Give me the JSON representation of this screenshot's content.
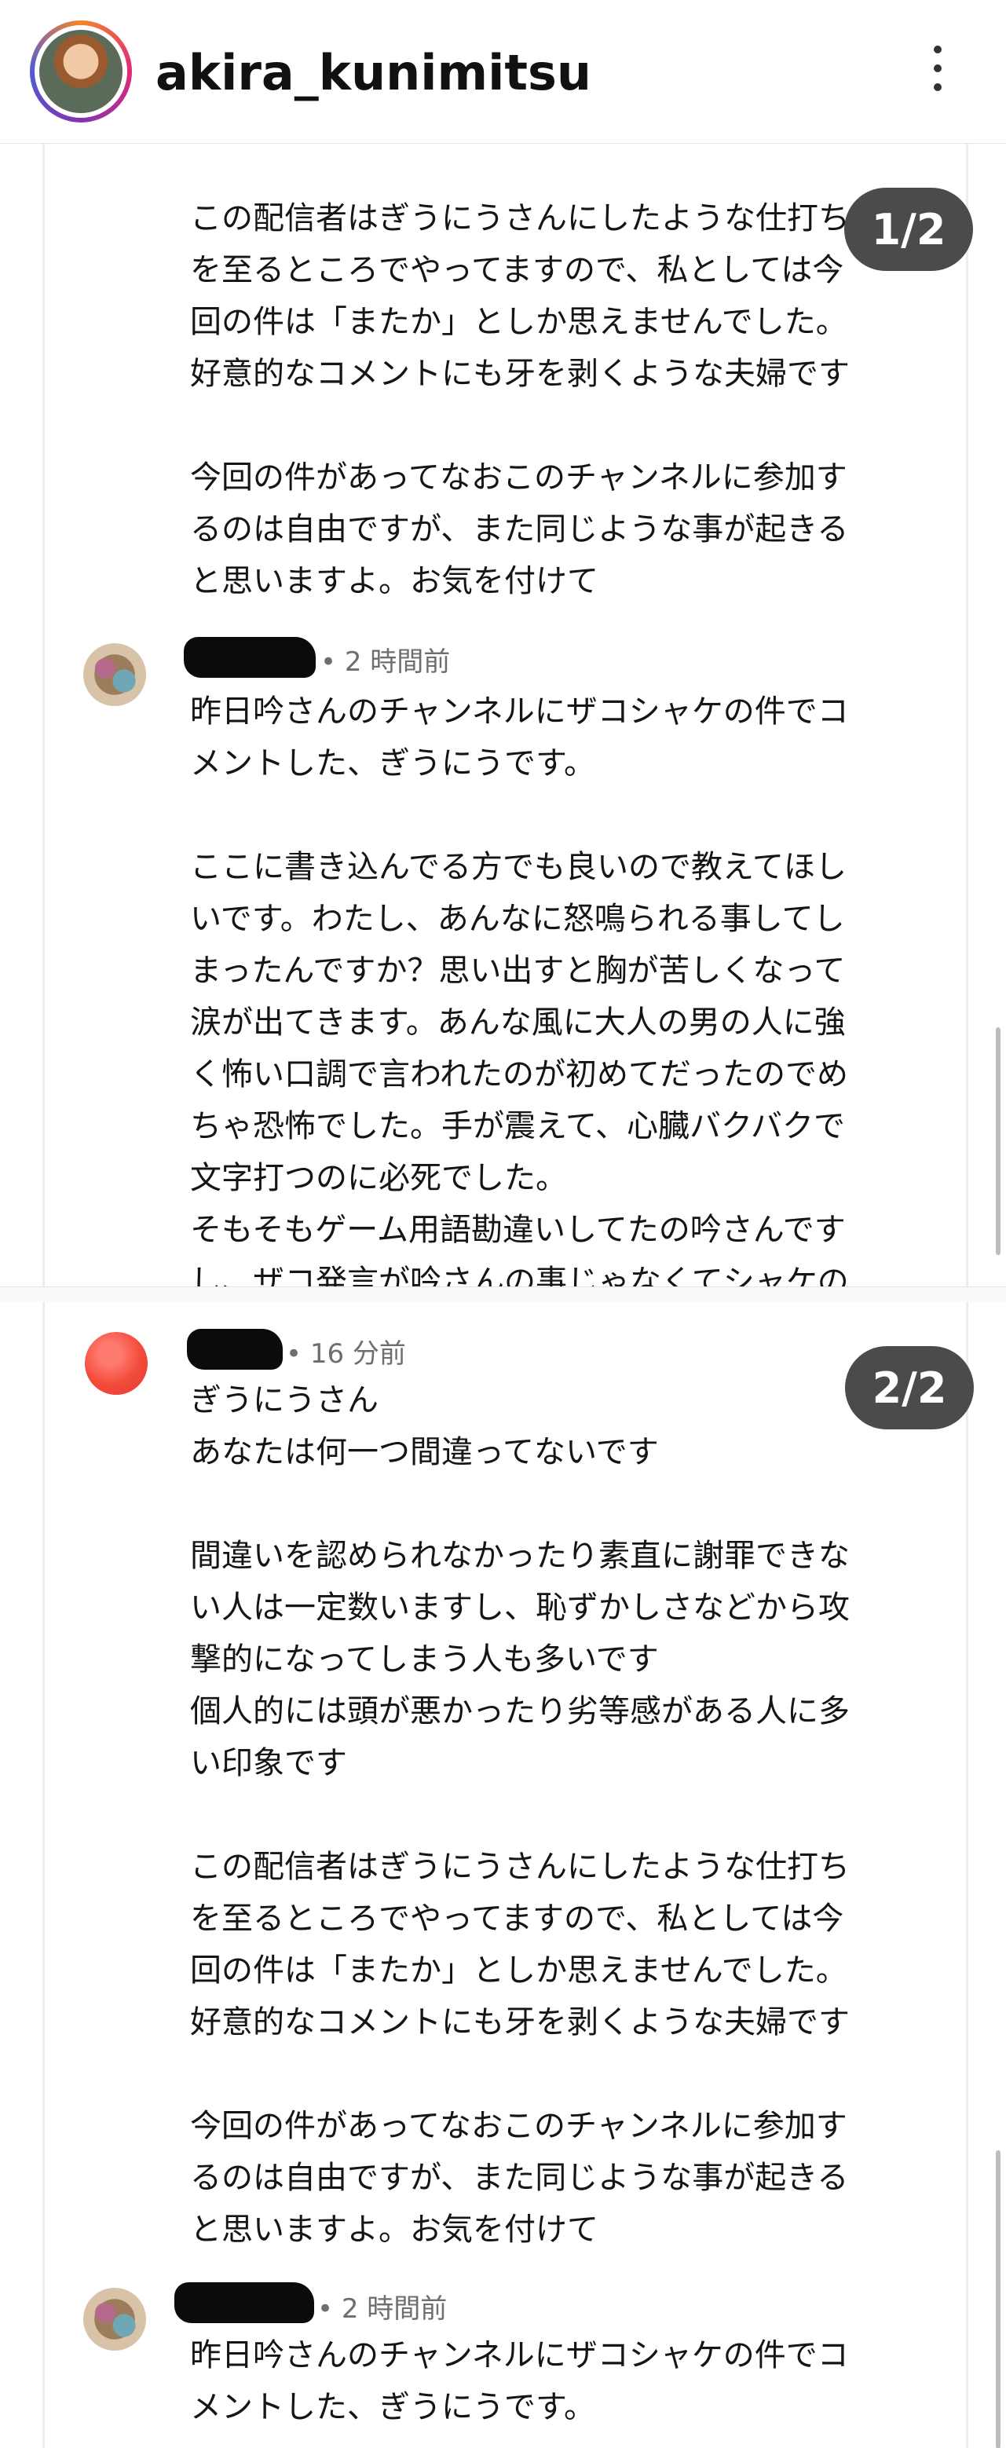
{
  "header": {
    "username": "akira_kunimitsu"
  },
  "pages": [
    {
      "badge": "1/2",
      "top_paragraphs": [
        "この配信者はぎうにうさんにしたような仕打ち\nを至るところでやってますので、私としては今\n回の件は「またか」としか思えませんでした。\n好意的なコメントにも牙を剥くような夫婦です",
        "今回の件があってなおこのチャンネルに参加す\nるのは自由ですが、また同じような事が起きる\nと思いますよ。お気を付けて"
      ],
      "comment": {
        "time": "• 2 時間前",
        "paragraphs": [
          "昨日吟さんのチャンネルにザコシャケの件でコ\nメントした、ぎうにうです。",
          "ここに書き込んでる方でも良いので教えてほし\nいです。わたし、あんなに怒鳴られる事してし\nまったんですか？思い出すと胸が苦しくなって\n涙が出てきます。あんな風に大人の男の人に強\nく怖い口調で言われたのが初めてだったのでめ\nちゃ恐怖でした。手が震えて、心臓バクバクで\n文字打つのに必死でした。\nそもそもゲーム用語勘違いしてたの吟さんです\nし、ザコ発言が吟さんの事じゃなくてシャケの"
        ]
      }
    },
    {
      "badge": "2/2",
      "comment_top": {
        "time": "• 16 分前",
        "paragraphs": [
          "ぎうにうさん\nあなたは何一つ間違ってないです",
          "間違いを認められなかったり素直に謝罪できな\nい人は一定数いますし、恥ずかしさなどから攻\n撃的になってしまう人も多いです\n個人的には頭が悪かったり劣等感がある人に多\nい印象です",
          "この配信者はぎうにうさんにしたような仕打ち\nを至るところでやってますので、私としては今\n回の件は「またか」としか思えませんでした。\n好意的なコメントにも牙を剥くような夫婦です",
          "今回の件があってなおこのチャンネルに参加す\nるのは自由ですが、また同じような事が起きる\nと思いますよ。お気を付けて"
        ]
      },
      "comment": {
        "time": "• 2 時間前",
        "paragraphs": [
          "昨日吟さんのチャンネルにザコシャケの件でコ\nメントした、ぎうにうです。"
        ]
      }
    }
  ]
}
